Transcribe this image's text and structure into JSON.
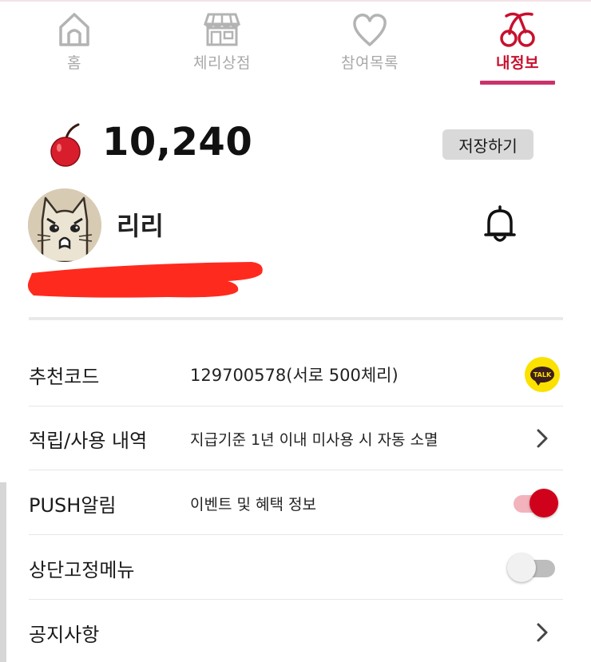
{
  "nav": {
    "tabs": [
      {
        "label": "홈",
        "icon": "home-icon",
        "active": false
      },
      {
        "label": "체리상점",
        "icon": "store-icon",
        "active": false
      },
      {
        "label": "참여목록",
        "icon": "heart-icon",
        "active": false
      },
      {
        "label": "내정보",
        "icon": "cherry-icon",
        "active": true
      }
    ]
  },
  "points": {
    "value": "10,240",
    "icon": "cherry-icon",
    "save_label": "저장하기"
  },
  "profile": {
    "name": "리리",
    "avatar": "cat-avatar",
    "notification_icon": "bell-icon"
  },
  "settings": {
    "rows": [
      {
        "title": "추천코드",
        "desc": "129700578(서로 500체리)",
        "action": "kakaotalk-share",
        "action_label": "TALK"
      },
      {
        "title": "적립/사용 내역",
        "desc": "지급기준 1년 이내 미사용 시 자동 소멸",
        "action": "chevron-right-icon"
      },
      {
        "title": "PUSH알림",
        "desc": "이벤트 및 혜택 정보",
        "action": "toggle",
        "toggle_on": true
      },
      {
        "title": "상단고정메뉴",
        "desc": "",
        "action": "toggle",
        "toggle_on": false
      },
      {
        "title": "공지사항",
        "desc": "",
        "action": "chevron-right-icon"
      }
    ]
  },
  "colors": {
    "accent": "#c8102e",
    "underline": "#c8336a",
    "inactive": "#a8a8a8",
    "kakao_yellow": "#fae100",
    "toggle_on": "#d0021b"
  }
}
